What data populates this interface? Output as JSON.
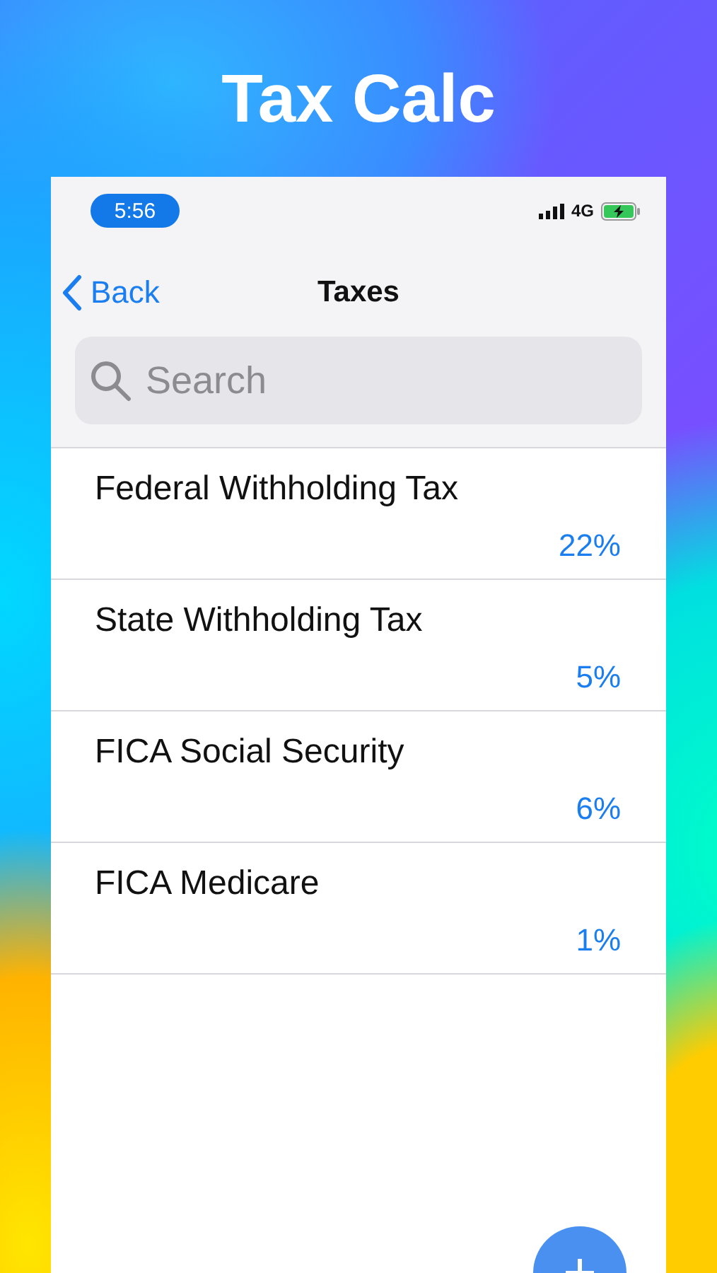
{
  "headline": "Tax Calc",
  "status_bar": {
    "time": "5:56",
    "network": "4G"
  },
  "nav": {
    "back": "Back",
    "title": "Taxes"
  },
  "search": {
    "placeholder": "Search"
  },
  "taxes": [
    {
      "name": "Federal Withholding Tax",
      "rate": "22%"
    },
    {
      "name": "State Withholding Tax",
      "rate": "5%"
    },
    {
      "name": "FICA Social Security",
      "rate": "6%"
    },
    {
      "name": "FICA Medicare",
      "rate": "1%"
    }
  ]
}
